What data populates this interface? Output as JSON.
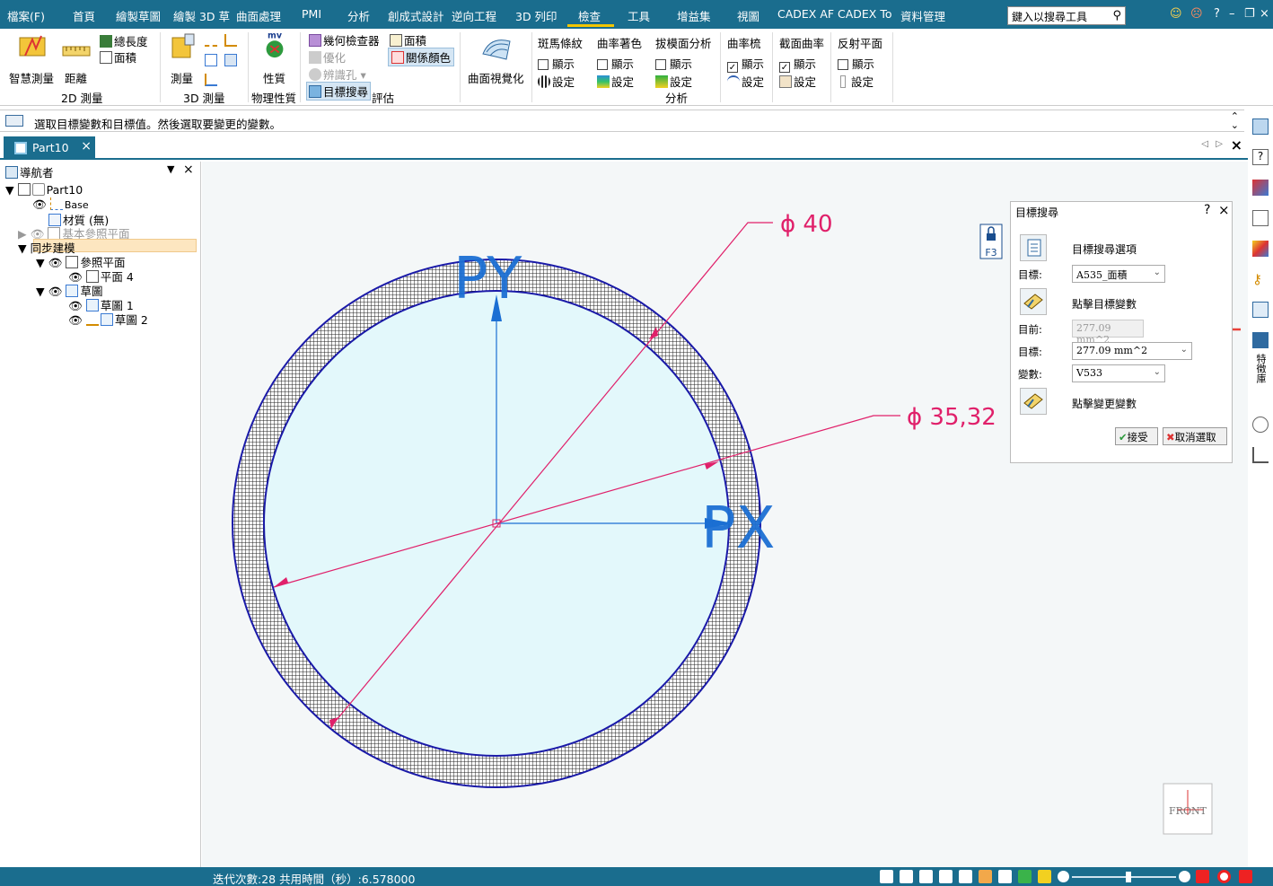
{
  "menu": {
    "items": [
      "檔案(F)",
      "首頁",
      "繪製草圖",
      "繪製 3D 草",
      "曲面處理",
      "PMI",
      "分析",
      "創成式設計",
      "逆向工程",
      "3D 列印",
      "檢查",
      "工具",
      "增益集",
      "視圖",
      "CADEX AF",
      "CADEX To",
      "資料管理"
    ],
    "active": "檢查",
    "search_placeholder": "鍵入以搜尋工具"
  },
  "ribbon": {
    "measure2d": {
      "smart_measure": "智慧測量",
      "distance": "距離",
      "total_length": "總長度",
      "area": "面積",
      "group": "2D 測量"
    },
    "measure3d": {
      "measure": "測量",
      "group": "3D 測量"
    },
    "physical": {
      "mass_label": "mv",
      "properties": "性質",
      "group": "物理性質"
    },
    "evaluate": {
      "geometry_checker": "幾何檢查器",
      "optimize": "優化",
      "identify_holes": "辨識孔",
      "goal_seek": "目標搜尋",
      "area": "面積",
      "relation_color": "關係顏色",
      "group_partial": "評估"
    },
    "surface_visual": {
      "label": "曲面視覺化"
    },
    "analysis": {
      "zebra": {
        "title": "斑馬條紋",
        "show": "顯示",
        "settings": "設定",
        "checked": false
      },
      "curvature_shade": {
        "title": "曲率著色",
        "show": "顯示",
        "settings": "設定",
        "checked": false
      },
      "draft": {
        "title": "拔模面分析",
        "show": "顯示",
        "settings": "設定",
        "checked": false
      },
      "group": "分析",
      "comb": {
        "title": "曲率梳",
        "show": "顯示",
        "settings": "設定",
        "checked": true
      },
      "section_curv": {
        "title": "截面曲率",
        "show": "顯示",
        "settings": "設定",
        "checked": true
      },
      "reflect": {
        "title": "反射平面",
        "show": "顯示",
        "settings": "設定",
        "checked": false
      }
    }
  },
  "prompt": "選取目標變數和目標值。然後選取要變更的變數。",
  "doc_tab": "Part10",
  "navigator": {
    "title": "導航者",
    "nodes": [
      "Part10",
      "Base",
      "材質 (無)",
      "基本參照平面",
      "同步建模",
      "參照平面",
      "平面 4",
      "草圖",
      "草圖 1",
      "草圖 2"
    ]
  },
  "canvas": {
    "dim_outer": "ϕ 40",
    "dim_inner": "ϕ 35,32",
    "axis_y": "PY",
    "axis_x": "PX",
    "lock_key": "F3",
    "view_label": "FRONT"
  },
  "dialog": {
    "title": "目標搜尋",
    "help": "?",
    "close": "×",
    "options_label": "目標搜尋選項",
    "target_label": "目標:",
    "target_value": "A535_面積",
    "click_target_var": "點擊目標變數",
    "current_label": "目前:",
    "current_value": "277.09 mm^2",
    "goal_label": "目標:",
    "goal_value": "277.09 mm^2",
    "variable_label": "變數:",
    "variable_value": "V533",
    "click_change_var": "點擊變更變數",
    "accept": "接受",
    "cancel": "取消選取"
  },
  "right_panel_label": "特徵庫",
  "status": {
    "text": "迭代次數:28  共用時間（秒）:6.578000"
  },
  "colors": {
    "theme": "#1a6d8e",
    "dimension": "#e0206a",
    "axis": "#1b6fd3",
    "circle_edge": "#1a1aa8",
    "fill": "#e3f8fb"
  }
}
